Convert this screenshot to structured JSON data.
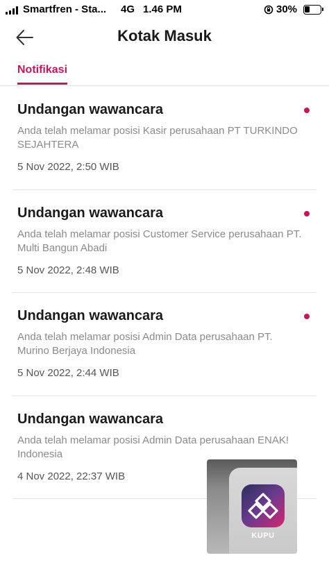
{
  "status_bar": {
    "carrier": "Smartfren - Sta...",
    "network": "4G",
    "time": "1.46 PM",
    "battery_percent": "30%"
  },
  "header": {
    "title": "Kotak Masuk",
    "back_icon": "arrow-left-icon"
  },
  "tabs": [
    {
      "label": "Notifikasi",
      "active": true
    }
  ],
  "notifications": [
    {
      "title": "Undangan wawancara",
      "body": "Anda telah melamar posisi Kasir perusahaan PT TURKINDO SEJAHTERA",
      "time": "5 Nov 2022, 2:50 WIB",
      "unread": true
    },
    {
      "title": "Undangan wawancara",
      "body": "Anda telah melamar posisi Customer Service perusahaan PT. Multi Bangun Abadi",
      "time": "5 Nov 2022, 2:48 WIB",
      "unread": true
    },
    {
      "title": "Undangan wawancara",
      "body": "Anda telah melamar posisi Admin Data perusahaan PT. Murino Berjaya Indonesia",
      "time": "5 Nov 2022, 2:44 WIB",
      "unread": true
    },
    {
      "title": "Undangan wawancara",
      "body": "Anda telah melamar posisi Admin Data perusahaan ENAK! Indonesia",
      "time": "4 Nov 2022, 22:37 WIB",
      "unread": false
    }
  ],
  "app_preview": {
    "label": "KUPU",
    "icon": "kupu-app-icon"
  },
  "colors": {
    "accent": "#c2185b",
    "divider": "#e3e3e3",
    "body_text": "#8a8a8a"
  }
}
